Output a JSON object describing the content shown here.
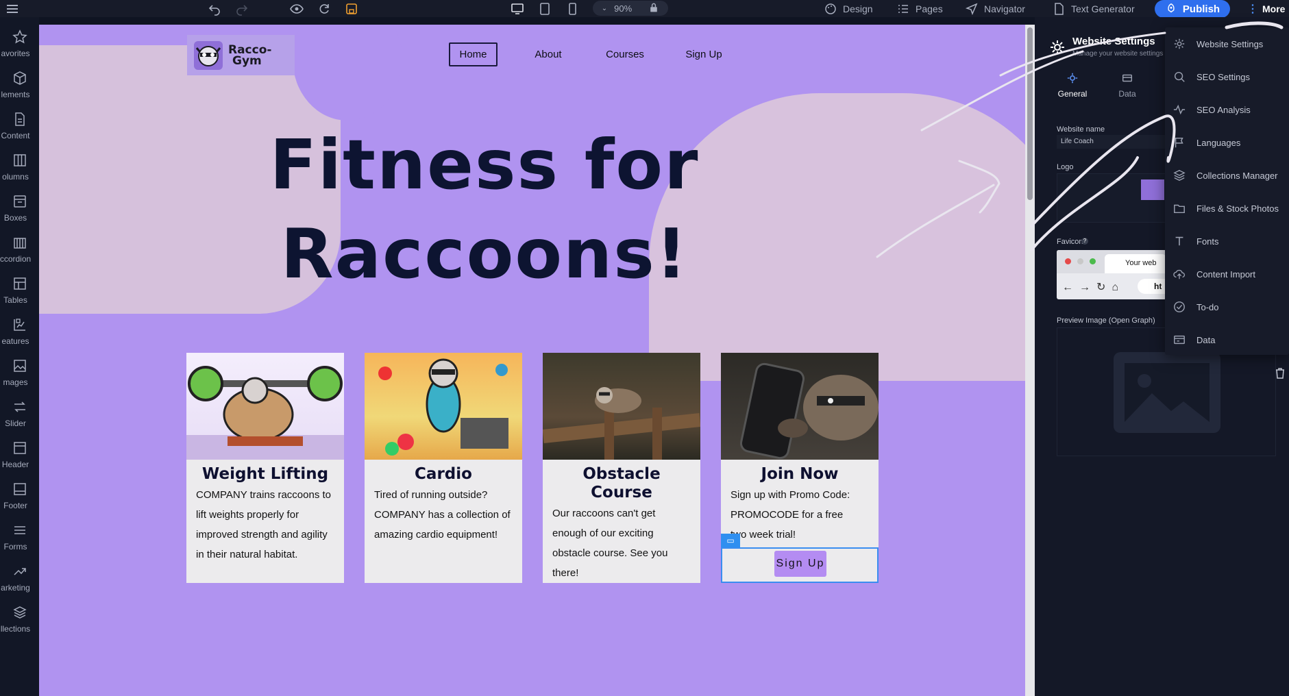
{
  "toolbar": {
    "zoom": "90%",
    "design": "Design",
    "pages": "Pages",
    "navigator": "Navigator",
    "text_generator": "Text Generator",
    "publish": "Publish",
    "more": "More"
  },
  "sidebar": {
    "items": [
      {
        "label": "avorites",
        "icon": "star-icon"
      },
      {
        "label": "lements",
        "icon": "cube-icon"
      },
      {
        "label": "Content",
        "icon": "document-icon"
      },
      {
        "label": "olumns",
        "icon": "columns-icon"
      },
      {
        "label": "Boxes",
        "icon": "box-icon"
      },
      {
        "label": "ccordion",
        "icon": "accordion-icon"
      },
      {
        "label": "Tables",
        "icon": "table-icon"
      },
      {
        "label": "eatures",
        "icon": "features-icon"
      },
      {
        "label": "mages",
        "icon": "image-icon"
      },
      {
        "label": "Slider",
        "icon": "slider-icon"
      },
      {
        "label": "Header",
        "icon": "header-icon"
      },
      {
        "label": "Footer",
        "icon": "footer-icon"
      },
      {
        "label": "Forms",
        "icon": "forms-icon"
      },
      {
        "label": "arketing",
        "icon": "trend-icon"
      },
      {
        "label": "llections",
        "icon": "layers-icon"
      }
    ]
  },
  "site": {
    "logo_text_1": "Racco-",
    "logo_text_2": "Gym",
    "nav": [
      "Home",
      "About",
      "Courses",
      "Sign Up"
    ],
    "hero_line_1": "Fitness for",
    "hero_line_2": "Raccoons!",
    "cards": [
      {
        "title": "Weight Lifting",
        "body": "COMPANY trains raccoons to lift weights properly for improved strength and agility in their natural habitat."
      },
      {
        "title": "Cardio",
        "body": "Tired of running outside? COMPANY has a collection of amazing cardio equipment!"
      },
      {
        "title_1": "Obstacle",
        "title_2": "Course",
        "body": "Our raccoons can't get enough of our exciting obstacle course. See you there!"
      },
      {
        "title": "Join Now",
        "body": "Sign up with Promo Code: PROMOCODE for a free two week trial!",
        "button": "Sign Up"
      }
    ]
  },
  "panel": {
    "title": "Website Settings",
    "subtitle": "Manage your website settings",
    "tabs": [
      "General",
      "Data"
    ],
    "website_name_label": "Website name",
    "website_name_value": "Life Coach",
    "logo_label": "Logo",
    "favicon_label": "Favicon",
    "favicon_preview_text": "Your web",
    "favicon_url_text": "ht",
    "preview_label": "Preview Image (Open Graph)"
  },
  "menu": {
    "items": [
      {
        "label": "Website Settings",
        "icon": "gear-icon"
      },
      {
        "label": "SEO Settings",
        "icon": "search-icon"
      },
      {
        "label": "SEO Analysis",
        "icon": "pulse-icon"
      },
      {
        "label": "Languages",
        "icon": "flag-icon"
      },
      {
        "label": "Collections Manager",
        "icon": "layers-icon"
      },
      {
        "label": "Files & Stock Photos",
        "icon": "folder-icon"
      },
      {
        "label": "Fonts",
        "icon": "font-icon"
      },
      {
        "label": "Content Import",
        "icon": "cloud-upload-icon"
      },
      {
        "label": "To-do",
        "icon": "check-circle-icon"
      },
      {
        "label": "Data",
        "icon": "data-icon"
      }
    ]
  },
  "colors": {
    "canvas_bg": "#b093f0",
    "blob": "#d8c2dd",
    "hero_text": "#0d1431",
    "publish": "#2f6fee",
    "editor_bg": "#141827"
  }
}
